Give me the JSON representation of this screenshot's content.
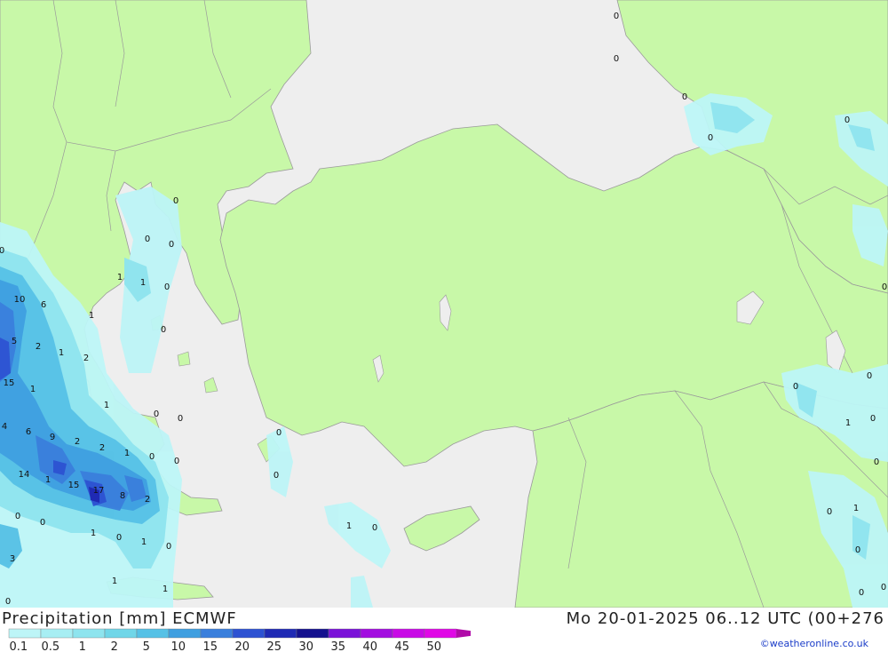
{
  "header": {
    "title": "Precipitation [mm] ECMWF",
    "valid_time": "Mo 20-01-2025 06..12 UTC (00+276",
    "credit": "©weatheronline.co.uk"
  },
  "legend": {
    "ticks": [
      "0.1",
      "0.5",
      "1",
      "2",
      "5",
      "10",
      "15",
      "20",
      "25",
      "30",
      "35",
      "40",
      "45",
      "50"
    ],
    "colors": [
      "#bdf5f7",
      "#a7eef3",
      "#8ee4ee",
      "#70d6e8",
      "#56c1e6",
      "#3f9fe0",
      "#3a7fdc",
      "#2d52d2",
      "#1f2ab4",
      "#14118e",
      "#7a12d8",
      "#a30ee0",
      "#c80ae6",
      "#e008e6",
      "#b00aa8"
    ]
  },
  "colors": {
    "land": "#c8f8a8",
    "sea": "#eeeeee",
    "border": "#9a9a9a"
  },
  "map_values": [
    "0",
    "0",
    "0",
    "0",
    "0",
    "0",
    "0",
    "0",
    "0",
    "1",
    "1",
    "0",
    "10",
    "6",
    "1",
    "0",
    "5",
    "2",
    "1",
    "2",
    "15",
    "1",
    "1",
    "0",
    "0",
    "4",
    "6",
    "9",
    "2",
    "2",
    "1",
    "0",
    "0",
    "14",
    "1",
    "15",
    "17",
    "8",
    "2",
    "0",
    "0",
    "1",
    "0",
    "1",
    "0",
    "3",
    "1",
    "1",
    "0",
    "0",
    "1",
    "0",
    "0",
    "0",
    "0",
    "0",
    "1",
    "0",
    "0",
    "0",
    "1",
    "0",
    "0",
    "0"
  ]
}
